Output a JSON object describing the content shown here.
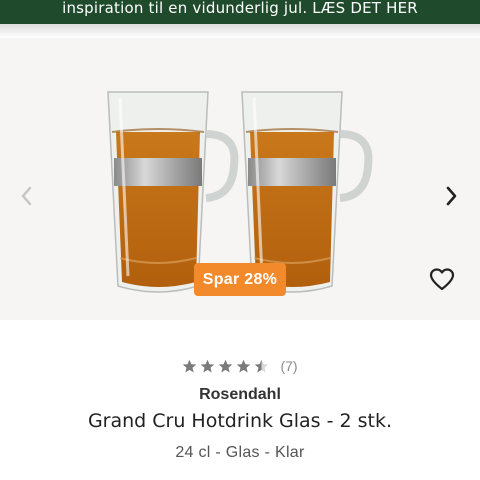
{
  "banner": {
    "text": "inspiration til en vidunderlig jul. LÆS DET HER"
  },
  "colors": {
    "banner_bg": "#1f4a2c",
    "badge_bg": "#f28a2c",
    "star_filled": "#7a7a7a",
    "gallery_bg": "#f6f5f3"
  },
  "gallery": {
    "prev_icon": "chevron-left-icon",
    "next_icon": "chevron-right-icon",
    "image_subject": "two glass tea cups with steel band filled with tea",
    "discount_badge": "Spar 28%",
    "wishlist_icon": "heart-icon"
  },
  "product": {
    "rating": {
      "value": 4.5,
      "max": 5,
      "count_label": "(7)"
    },
    "brand": "Rosendahl",
    "title": "Grand Cru Hotdrink Glas - 2 stk.",
    "variant": "24 cl - Glas - Klar"
  }
}
